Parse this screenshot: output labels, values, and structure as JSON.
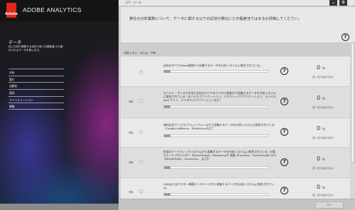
{
  "app": {
    "title": "ADOBE ANALYTICS",
    "logo_text": "Adobe"
  },
  "sidebar": {
    "section_title": "データ",
    "description": "社にお持ち業務する目的で使うな業数通 から集められるデータを扱います。",
    "nav": [
      "分析",
      "実行",
      "自動化",
      "適用",
      "アトリビューション",
      "戦略"
    ]
  },
  "topbar": {
    "progress": "1/7 - データ",
    "expand_icon": "⌄",
    "gear_icon": "⚙"
  },
  "question": {
    "text": "貴社の分析業務について、データに関する以下の記述が貴社にどの程度当てはまるか評価してください。"
  },
  "column_header": "回答しない、または、不明",
  "rows": [
    {
      "text": "自社のすべてのweb資産から収集するデータを分析システムに統合されている。",
      "option_label": "",
      "percent": "0",
      "scale_label": "全く当てはまらない"
    },
    {
      "text": "モバイル・チャネルを含む全社のすべてのデジタル資産から収集するデータを分析システムに統合されている（モバイルアプリケーション、デスクトップアプリケーション、モバイルweb サイト、デジタルパブリケーションなど）",
      "option_label": "不明",
      "percent": "0",
      "scale_label": "全く当てはまらない"
    },
    {
      "text": "有料広告サービス/プラットフォームから収集するデータを分析システムに統合されている（Google AdWords、Brightcoveなど）",
      "option_label": "不明",
      "percent": "0",
      "scale_label": "全く当てはまらない"
    },
    {
      "text": "外部のマーケティングシステムから収集するデータを分析システムに統合されている（E電子メールプロバイダー【ExactTarget、Responsys】調査【ForeSee、OpinionLab】SEO【BrightEdge、Conductor、など】）",
      "option_label": "不明",
      "percent": "0",
      "scale_label": "全く当てはまらない"
    },
    {
      "text": "CRMまたはマスター顧客データベースから収集するデータを分析システムに統合されている。",
      "option_label": "不明",
      "percent": "0",
      "scale_label": "全く当てはまらない"
    }
  ],
  "percent_suffix": "%",
  "help_icon_text": "?",
  "next_button": "次へ"
}
